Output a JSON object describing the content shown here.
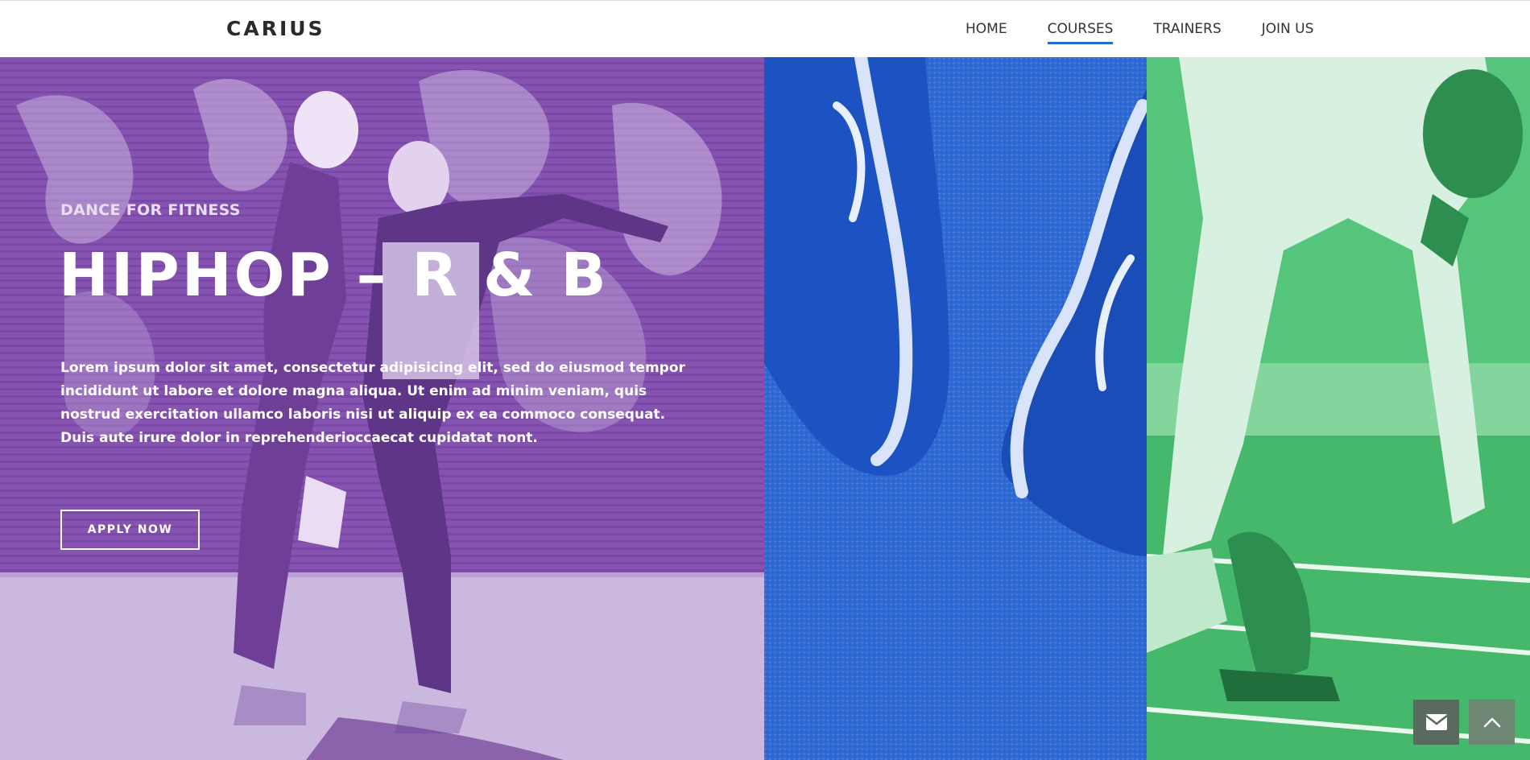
{
  "header": {
    "logo": "CARIUS",
    "nav": [
      {
        "label": "HOME",
        "active": false
      },
      {
        "label": "COURSES",
        "active": true
      },
      {
        "label": "TRAINERS",
        "active": false
      },
      {
        "label": "JOIN US",
        "active": false
      }
    ],
    "accent_color": "#1f6fd1"
  },
  "hero": {
    "eyebrow": "DANCE FOR FITNESS",
    "title": "HIPHOP – R & B",
    "body": "Lorem ipsum dolor sit amet, consectetur adipisicing elit, sed do eiusmod tempor incididunt ut labore et dolore magna aliqua. Ut enim ad minim veniam, quis nostrud exercitation ullamco laboris nisi ut aliquip ex ea commoco consequat. Duis aute irure dolor in reprehenderioccaecat cupidatat nont.",
    "cta_label": "APPLY NOW"
  },
  "panels": {
    "left_color": "#8a55b4",
    "middle_color": "#2c66d2",
    "right_color": "#4ec276"
  },
  "floating_buttons": {
    "mail_icon": "envelope-icon",
    "top_icon": "chevron-up-icon"
  }
}
